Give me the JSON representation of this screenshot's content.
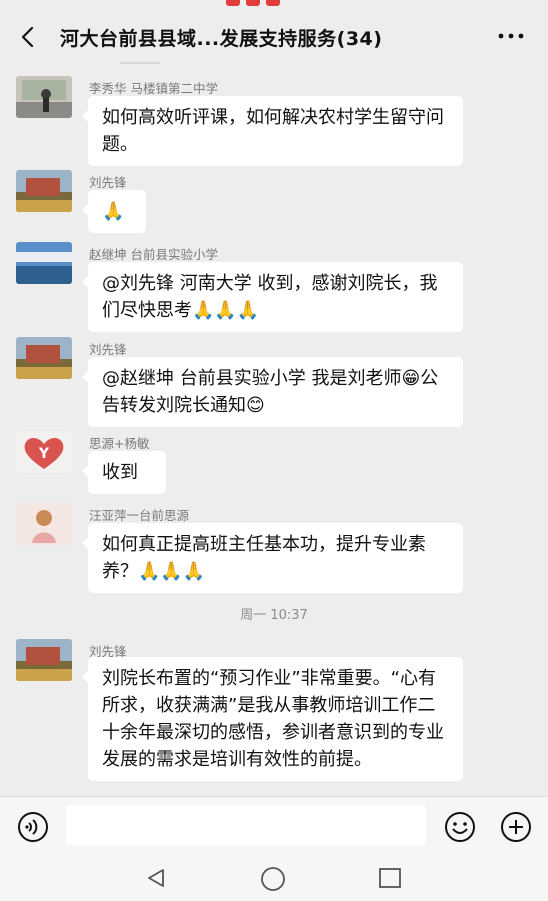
{
  "header": {
    "title": "河大台前县县域...发展支持服务(34)"
  },
  "messages": [
    {
      "sender": "李秀华 马楼镇第二中学",
      "text": "如何高效听评课，如何解决农村学生留守问题。",
      "avatar": "avatar-1"
    },
    {
      "sender": "刘先锋",
      "text": "🙏",
      "avatar": "avatar-2"
    },
    {
      "sender": "赵继坤  台前县实验小学",
      "text": "@刘先锋 河南大学  收到，感谢刘院长，我们尽快思考🙏🙏🙏",
      "avatar": "avatar-3"
    },
    {
      "sender": "刘先锋",
      "text": "@赵继坤  台前县实验小学  我是刘老师😁公告转发刘院长通知😊",
      "avatar": "avatar-2"
    },
    {
      "sender": "思源+杨敏",
      "text": "收到",
      "avatar": "avatar-heart"
    },
    {
      "sender": "汪亚萍一台前思源",
      "text": "如何真正提高班主任基本功，提升专业素养？🙏🙏🙏",
      "avatar": "avatar-5"
    },
    {
      "sender": "刘先锋",
      "text": "刘院长布置的“预习作业”非常重要。“心有所求，收获满满”是我从事教师培训工作二十余年最深切的感悟，参训者意识到的专业发展的需求是培训有效性的前提。",
      "avatar": "avatar-2"
    }
  ],
  "timestamp": "周一 10:37",
  "input": {
    "value": ""
  },
  "icons": {
    "back": "chevron-left-icon",
    "more": "more-dots-icon",
    "voice": "voice-icon",
    "emoji": "emoji-icon",
    "plus": "plus-icon",
    "nav_back": "triangle-back-icon",
    "nav_home": "circle-home-icon",
    "nav_recent": "square-recent-icon"
  },
  "colors": {
    "background": "#ededed",
    "bubble": "#ffffff"
  }
}
